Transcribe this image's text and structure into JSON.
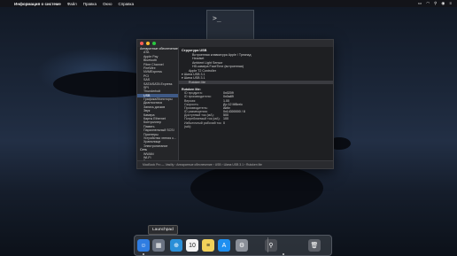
{
  "menubar": {
    "app_name": "Информация о системе",
    "items": [
      "Файл",
      "Правка",
      "Окно",
      "Справка"
    ],
    "right_icons": [
      "battery-icon",
      "wifi-icon",
      "search-icon",
      "siri-icon",
      "control-center-icon"
    ]
  },
  "window": {
    "sidebar": [
      {
        "label": "Аппаратные обеспечение",
        "group": true
      },
      {
        "label": "ATA"
      },
      {
        "label": "Apple Pay"
      },
      {
        "label": "Bluetooth"
      },
      {
        "label": "Fibre Channel"
      },
      {
        "label": "FireWire"
      },
      {
        "label": "NVMExpress"
      },
      {
        "label": "PCI"
      },
      {
        "label": "SAS"
      },
      {
        "label": "SATA/SATA Express"
      },
      {
        "label": "SPI"
      },
      {
        "label": "Thunderbolt"
      },
      {
        "label": "USB",
        "selected": true
      },
      {
        "label": "Графика/Мониторы"
      },
      {
        "label": "Диагностика"
      },
      {
        "label": "Запись дисков"
      },
      {
        "label": "Звук"
      },
      {
        "label": "Камера"
      },
      {
        "label": "Карты Ethernet"
      },
      {
        "label": "Контроллер"
      },
      {
        "label": "Память"
      },
      {
        "label": "Параллельный SCSI"
      },
      {
        "label": "Принтеры"
      },
      {
        "label": "Устройства чтения к..."
      },
      {
        "label": "Хранилище"
      },
      {
        "label": "Электропитание"
      },
      {
        "label": "Сеть",
        "group": true
      },
      {
        "label": "WWAN"
      },
      {
        "label": "Wi-Fi"
      },
      {
        "label": "Брандмауэр"
      }
    ],
    "tree_header": "Структура USB",
    "tree": [
      {
        "label": "Встроенная клавиатура Apple / Трекпад",
        "indent": 3
      },
      {
        "label": "Headset",
        "indent": 3
      },
      {
        "label": "Ambient Light Sensor",
        "indent": 3
      },
      {
        "label": "HD-камера FaceTime (встроенная)",
        "indent": 3
      },
      {
        "label": "Apple T2 Controller",
        "indent": 2
      },
      {
        "label": "▾ Шина USB 3.1",
        "indent": 0
      },
      {
        "label": "▾ Шина USB 3.1",
        "indent": 0
      },
      {
        "label": "Rutoken lite",
        "indent": 2,
        "selected": true
      }
    ],
    "detail_title": "Rutoken lite:",
    "details": [
      {
        "k": "ID продукта:",
        "v": "0x0209"
      },
      {
        "k": "ID производителя:",
        "v": "0x0a89"
      },
      {
        "k": "Версия:",
        "v": "1.00"
      },
      {
        "k": "Скорость:",
        "v": "До 12 Мбит/с"
      },
      {
        "k": "Производитель:",
        "v": "Aktiv"
      },
      {
        "k": "ID размещения:",
        "v": "0x14300000 / 8"
      },
      {
        "k": "Доступный ток (мА):",
        "v": "500"
      },
      {
        "k": "Потребляемый ток (мА):",
        "v": "100"
      },
      {
        "k": "Избыточный рабочий ток (мА):",
        "v": "0"
      }
    ],
    "statusbar": "MacBook Pro — Vasiliy › Аппаратные обеспечение › USB › Шина USB 3.1 › Rutoken lite"
  },
  "tooltip": "Launchpad",
  "dock": [
    {
      "name": "finder-icon",
      "glyph": "☺",
      "color": "#2f7de1"
    },
    {
      "name": "launchpad-icon",
      "glyph": "▦",
      "color": "#6b7382"
    },
    {
      "name": "safari-icon",
      "glyph": "⊕",
      "color": "#2a8fd8"
    },
    {
      "name": "calendar-icon",
      "glyph": "10",
      "color": "#f2f2f2"
    },
    {
      "name": "notes-icon",
      "glyph": "≡",
      "color": "#f1d15a"
    },
    {
      "name": "appstore-icon",
      "glyph": "A",
      "color": "#1e8ff0"
    },
    {
      "name": "system-preferences-icon",
      "glyph": "⚙",
      "color": "#8a8f98"
    },
    {
      "name": "system-information-icon",
      "glyph": "⚲",
      "color": "#4a4d54"
    },
    {
      "name": "trash-icon",
      "glyph": "🗑",
      "color": "#5a5e66"
    }
  ]
}
